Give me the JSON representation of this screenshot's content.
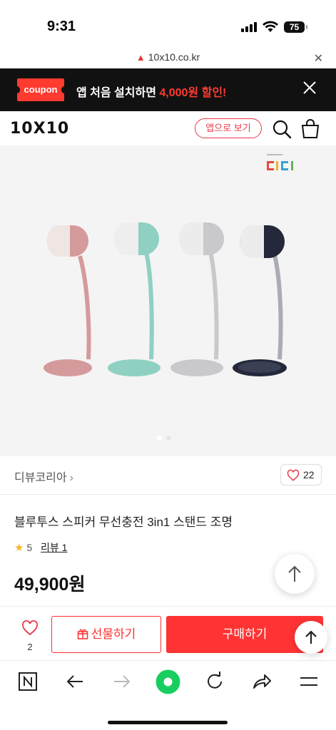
{
  "status": {
    "time": "9:31",
    "battery": "75"
  },
  "browser": {
    "url": "10x10.co.kr"
  },
  "coupon_banner": {
    "tag": "coupon",
    "text_prefix": "앱 처음 설치하면 ",
    "text_highlight": "4,000원 할인!"
  },
  "header": {
    "logo": "10X10",
    "app_button": "앱으로 보기"
  },
  "product": {
    "brand": "디뷰코리아",
    "likes": "22",
    "title": "블루투스 스피커 무선충전 3in1 스탠드 조명",
    "rating": "5",
    "review_label": "리뷰 1",
    "price": "49,900원",
    "image_brand_mark": "CICI",
    "lamp_colors": [
      "#d59a9c",
      "#8fd0c2",
      "#c9c9cd",
      "#24283a"
    ]
  },
  "purchase_bar": {
    "wish_count": "2",
    "gift_label": "선물하기",
    "buy_label": "구매하기"
  },
  "colors": {
    "accent": "#ff3333",
    "coupon_bg": "#111111"
  }
}
